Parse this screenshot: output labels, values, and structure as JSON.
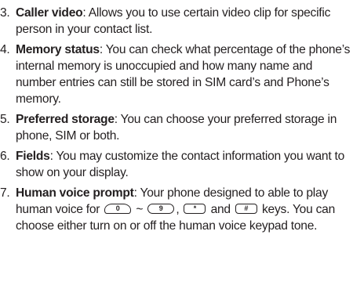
{
  "items": [
    {
      "number": "3.",
      "term": "Caller video",
      "text": ": Allows you to use certain video clip for specific person in your contact list."
    },
    {
      "number": "4.",
      "term": "Memory status",
      "text": ": You can check what percentage of the phone’s internal memory is unoccupied and how many name and number entries can still be stored in SIM card’s and Phone’s memory."
    },
    {
      "number": "5.",
      "term": "Preferred storage",
      "text": ": You can choose your preferred storage in phone, SIM or both."
    },
    {
      "number": "6.",
      "term": "Fields",
      "text": ": You may customize the contact information you want to show on your display."
    },
    {
      "number": "7.",
      "term": "Human voice prompt",
      "text_a": ": Your phone designed to able to play human voice for ",
      "tilde": " ~ ",
      "comma": ", ",
      "and": " and ",
      "text_b": " keys. You can choose either turn on or off the human voice keypad tone.",
      "keys": {
        "key_0": "0",
        "key_9": "9",
        "key_star": "*",
        "key_hash": "#"
      }
    }
  ]
}
